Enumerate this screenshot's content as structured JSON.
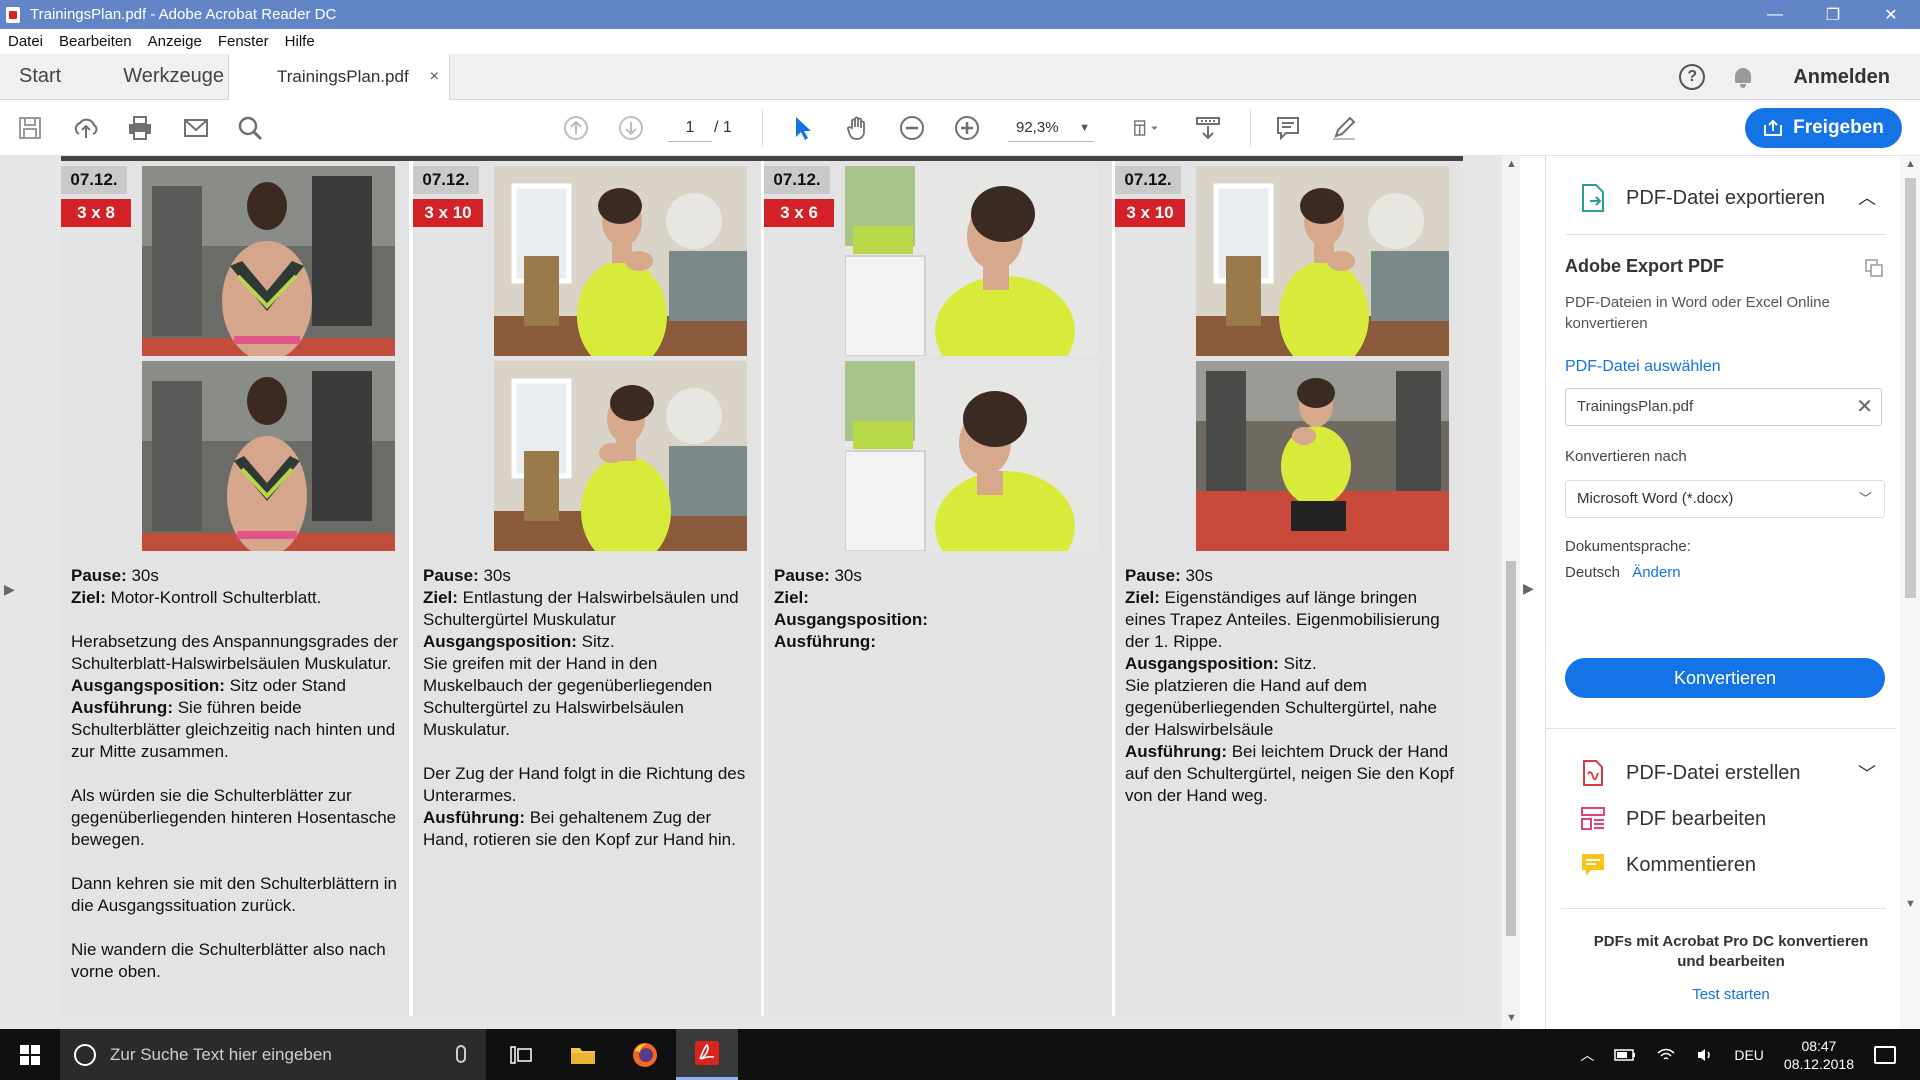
{
  "window": {
    "title": "TrainingsPlan.pdf - Adobe Acrobat Reader DC",
    "controls": [
      "—",
      "❐",
      "✕"
    ]
  },
  "menu": [
    "Datei",
    "Bearbeiten",
    "Anzeige",
    "Fenster",
    "Hilfe"
  ],
  "tabs": {
    "start": "Start",
    "tools": "Werkzeuge",
    "document": "TrainingsPlan.pdf",
    "close": "×",
    "help": "?",
    "signin": "Anmelden"
  },
  "toolbar": {
    "page_current": "1",
    "page_total": "/ 1",
    "zoom": "92,3%",
    "share_label": "Freigeben",
    "icons": [
      "save-icon",
      "upload-icon",
      "print-icon",
      "mail-icon",
      "search-icon",
      "page-up-icon",
      "page-down-icon",
      "select-arrow-icon",
      "hand-icon",
      "zoom-out-icon",
      "zoom-in-icon",
      "page-layout-icon",
      "scroll-mode-icon",
      "comment-icon",
      "pen-icon"
    ]
  },
  "document": {
    "columns": [
      {
        "date": "07.12.",
        "sets": "3 x 8",
        "lines": [
          {
            "b": "Pause:",
            "t": " 30s"
          },
          {
            "b": "Ziel:",
            "t": " Motor-Kontroll Schulterblatt."
          },
          {
            "gap": true
          },
          {
            "b": "",
            "t": "Herabsetzung des Anspannungsgrades der Schulterblatt-Halswirbelsäulen Muskulatur."
          },
          {
            "b": "Ausgangsposition:",
            "t": " Sitz oder Stand"
          },
          {
            "b": "Ausführung:",
            "t": " Sie führen beide Schulterblätter gleichzeitig nach hinten und zur Mitte zusammen."
          },
          {
            "gap": true
          },
          {
            "b": "",
            "t": "Als würden sie die Schulterblätter zur gegenüberliegenden hinteren Hosentasche bewegen."
          },
          {
            "gap": true
          },
          {
            "b": "",
            "t": "Dann kehren sie mit den Schulterblättern in die Ausgangssituation zurück."
          },
          {
            "gap": true
          },
          {
            "b": "",
            "t": "Nie wandern die Schulterblätter also nach vorne oben."
          }
        ]
      },
      {
        "date": "07.12.",
        "sets": "3 x 10",
        "lines": [
          {
            "b": "Pause:",
            "t": " 30s"
          },
          {
            "b": "Ziel:",
            "t": " Entlastung der Halswirbelsäulen und Schultergürtel Muskulatur"
          },
          {
            "b": "Ausgangsposition:",
            "t": " Sitz."
          },
          {
            "b": "",
            "t": "Sie greifen mit der Hand in den Muskelbauch der gegenüberliegenden Schultergürtel zu Halswirbelsäulen Muskulatur."
          },
          {
            "gap": true
          },
          {
            "b": "",
            "t": "Der Zug der Hand folgt in die Richtung des Unterarmes."
          },
          {
            "b": "Ausführung:",
            "t": " Bei gehaltenem Zug der Hand, rotieren sie den Kopf zur Hand hin."
          }
        ]
      },
      {
        "date": "07.12.",
        "sets": "3 x 6",
        "lines": [
          {
            "b": "Pause:",
            "t": " 30s"
          },
          {
            "b": "Ziel:",
            "t": ""
          },
          {
            "b": "Ausgangsposition:",
            "t": ""
          },
          {
            "b": "Ausführung:",
            "t": ""
          }
        ]
      },
      {
        "date": "07.12.",
        "sets": "3 x 10",
        "lines": [
          {
            "b": "Pause:",
            "t": " 30s"
          },
          {
            "b": "Ziel:",
            "t": " Eigenständiges auf länge bringen eines Trapez Anteiles. Eigenmobilisierung der 1. Rippe."
          },
          {
            "b": "Ausgangsposition:",
            "t": " Sitz."
          },
          {
            "b": "",
            "t": "Sie platzieren die Hand auf dem gegenüberliegenden Schultergürtel, nahe der Halswirbelsäule"
          },
          {
            "b": "Ausführung:",
            "t": " Bei leichtem Druck der Hand auf den Schultergürtel, neigen Sie den Kopf von der Hand weg."
          }
        ]
      }
    ]
  },
  "right_pane": {
    "export_header": "PDF-Datei exportieren",
    "export_title": "Adobe Export PDF",
    "export_desc": "PDF-Dateien in Word oder Excel Online konvertieren",
    "select_file": "PDF-Datei auswählen",
    "file_name": "TrainingsPlan.pdf",
    "convert_to_label": "Konvertieren nach",
    "convert_to_value": "Microsoft Word (*.docx)",
    "doc_lang_label": "Dokumentsprache:",
    "doc_lang_value": "Deutsch",
    "doc_lang_change": "Ändern",
    "convert_button": "Konvertieren",
    "tool_create": "PDF-Datei erstellen",
    "tool_edit": "PDF bearbeiten",
    "tool_comment": "Kommentieren",
    "promo": "PDFs mit Acrobat Pro DC konvertieren und bearbeiten",
    "trial": "Test starten"
  },
  "taskbar": {
    "search_placeholder": "Zur Suche Text hier eingeben",
    "lang": "DEU",
    "time": "08:47",
    "date": "08.12.2018"
  },
  "colors": {
    "titlebar": "#6185c6",
    "accent_blue": "#1473e6",
    "badge_red": "#d42027"
  }
}
